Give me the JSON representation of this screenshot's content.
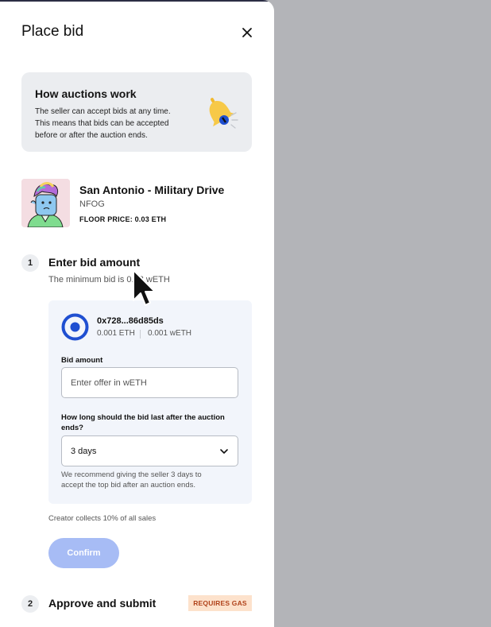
{
  "dialog": {
    "title": "Place bid"
  },
  "info_box": {
    "title": "How auctions work",
    "text": "The seller can accept bids at any time. This means that bids can be accepted before or after the auction ends.",
    "icon": "bell-icon"
  },
  "nft": {
    "name": "San Antonio - Military Drive",
    "collection": "NFOG",
    "floor_price": "FLOOR PRICE: 0.03 ETH"
  },
  "step1": {
    "number": "1",
    "title": "Enter bid amount",
    "subtitle": "The minimum bid is 0.03 wETH"
  },
  "wallet": {
    "address": "0x728...86d85ds",
    "eth_balance": "0.001 ETH",
    "weth_balance": "0.001 wETH"
  },
  "bid_form": {
    "bid_label": "Bid amount",
    "bid_placeholder": "Enter offer in wETH",
    "bid_value": "",
    "duration_label": "How long should the bid last after the auction ends?",
    "duration_value": "3 days",
    "hint": "We recommend giving the seller 3 days to accept the top bid after an auction ends."
  },
  "creator_note": "Creator collects 10% of all sales",
  "confirm_label": "Confirm",
  "step2": {
    "number": "2",
    "title": "Approve and submit",
    "badge": "REQUIRES GAS"
  },
  "colors": {
    "accent": "#1f4fd1",
    "confirm_disabled": "#a7bcf5",
    "badge_bg": "#fde2cc",
    "badge_text": "#b0421a",
    "form_bg": "#f2f5fb",
    "info_bg": "#ebedf0",
    "backdrop": "#b3b4b8"
  }
}
